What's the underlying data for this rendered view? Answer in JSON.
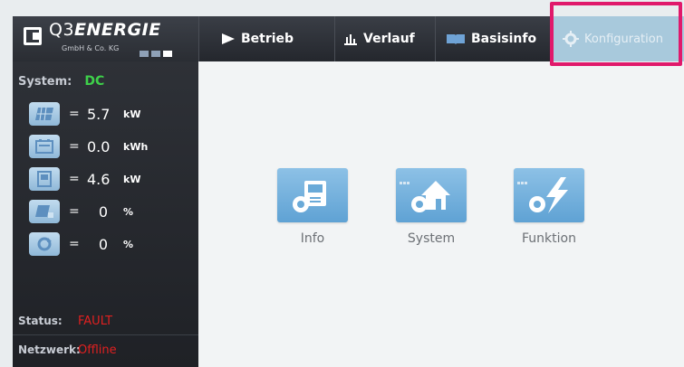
{
  "header": {
    "logo_prefix": "Q3",
    "logo_name": "ENERGIE",
    "logo_sub": "GmbH & Co. KG",
    "tabs": [
      {
        "label": "Betrieb",
        "icon": "play-icon"
      },
      {
        "label": "Verlauf",
        "icon": "bar-chart-icon"
      },
      {
        "label": "Basisinfo",
        "icon": "book-icon"
      },
      {
        "label": "Konfiguration",
        "icon": "gear-icon",
        "active": true
      }
    ]
  },
  "sidebar": {
    "system_label": "System:",
    "system_value": "DC",
    "metrics": [
      {
        "icon": "solar-panel-icon",
        "eq": "=",
        "value": "5.7",
        "unit": "kW"
      },
      {
        "icon": "battery-energy-icon",
        "eq": "=",
        "value": "0.0",
        "unit": "kWh"
      },
      {
        "icon": "inverter-icon",
        "eq": "=",
        "value": "4.6",
        "unit": "kW"
      },
      {
        "icon": "panel-percent-icon",
        "eq": "=",
        "value": "0",
        "unit": "%"
      },
      {
        "icon": "cycle-percent-icon",
        "eq": "=",
        "value": "0",
        "unit": "%"
      }
    ],
    "status_label": "Status:",
    "status_value": "FAULT",
    "network_label": "Netzwerk:",
    "network_value": "Offline"
  },
  "main": {
    "tiles": [
      {
        "label": "Info",
        "icon": "info-disk-icon"
      },
      {
        "label": "System",
        "icon": "house-gear-icon"
      },
      {
        "label": "Funktion",
        "icon": "lightning-gear-icon"
      }
    ]
  },
  "colors": {
    "accent_highlight": "#e0196b",
    "active_tab": "#a8c9dc",
    "status_ok": "#3ed04a",
    "status_fault": "#e02020",
    "tile_blue": "#6aaad8"
  }
}
